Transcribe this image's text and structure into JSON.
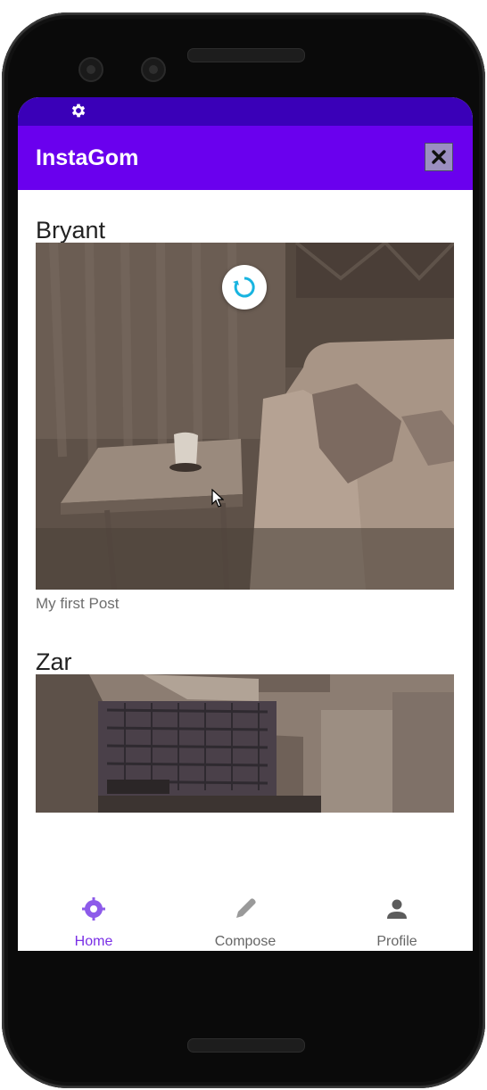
{
  "app": {
    "title": "InstaGom",
    "status_icon": "gear-icon",
    "close_icon": "close-icon"
  },
  "posts": [
    {
      "author": "Bryant",
      "caption": "My first Post",
      "image": "living-room-photo"
    },
    {
      "author": "Zar",
      "caption": "",
      "image": "kitchen-photo"
    }
  ],
  "bottom_nav": {
    "items": [
      {
        "label": "Home",
        "icon": "home-target-icon",
        "active": true
      },
      {
        "label": "Compose",
        "icon": "pencil-icon",
        "active": false
      },
      {
        "label": "Profile",
        "icon": "person-icon",
        "active": false
      }
    ]
  },
  "colors": {
    "status_bar": "#3a00b8",
    "app_bar": "#6a00ee",
    "accent": "#7a2fe6",
    "refresh_indicator": "#18b4e0"
  }
}
